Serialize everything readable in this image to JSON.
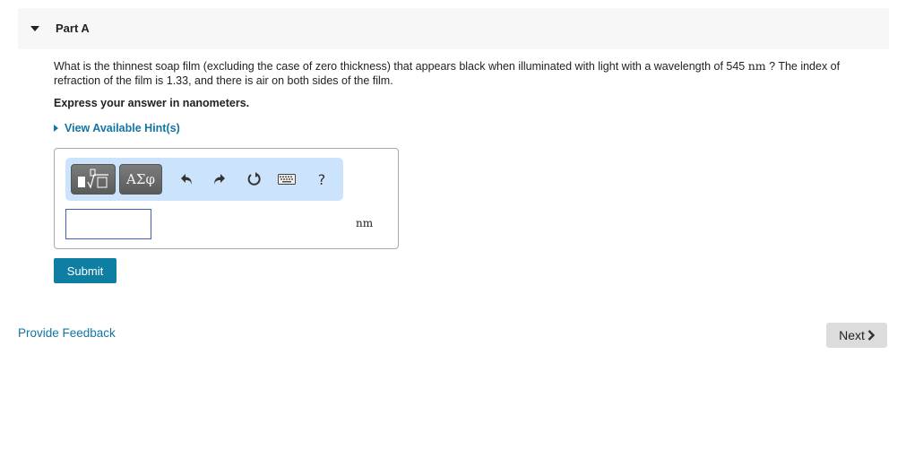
{
  "part": {
    "title": "Part A",
    "collapse_icon": "caret-down-icon"
  },
  "question": {
    "text_before": "What is the thinnest soap film (excluding the case of zero thickness) that appears black when illuminated with light with a wavelength of 545 ",
    "unit_inline": "nm",
    "text_after": " ? The index of refraction of the film is 1.33, and there is air on both sides of the film.",
    "instruction": "Express your answer in nanometers."
  },
  "hint": {
    "label": "View Available Hint(s)",
    "icon": "caret-right-icon"
  },
  "toolbar": {
    "templates_icon": "templates-icon",
    "symbols_label": "ΑΣφ",
    "undo_icon": "undo-icon",
    "redo_icon": "redo-icon",
    "reset_icon": "reset-icon",
    "keyboard_icon": "keyboard-icon",
    "help_label": "?"
  },
  "answer": {
    "value": "",
    "placeholder": "",
    "unit": "nm"
  },
  "buttons": {
    "submit": "Submit",
    "next": "Next",
    "next_icon": "chevron-right-icon"
  },
  "links": {
    "feedback": "Provide Feedback"
  },
  "colors": {
    "accent": "#0f7ea3",
    "link": "#1275a2",
    "toolbar_bg": "#cce4fb",
    "header_bg": "#f7f7f7"
  }
}
